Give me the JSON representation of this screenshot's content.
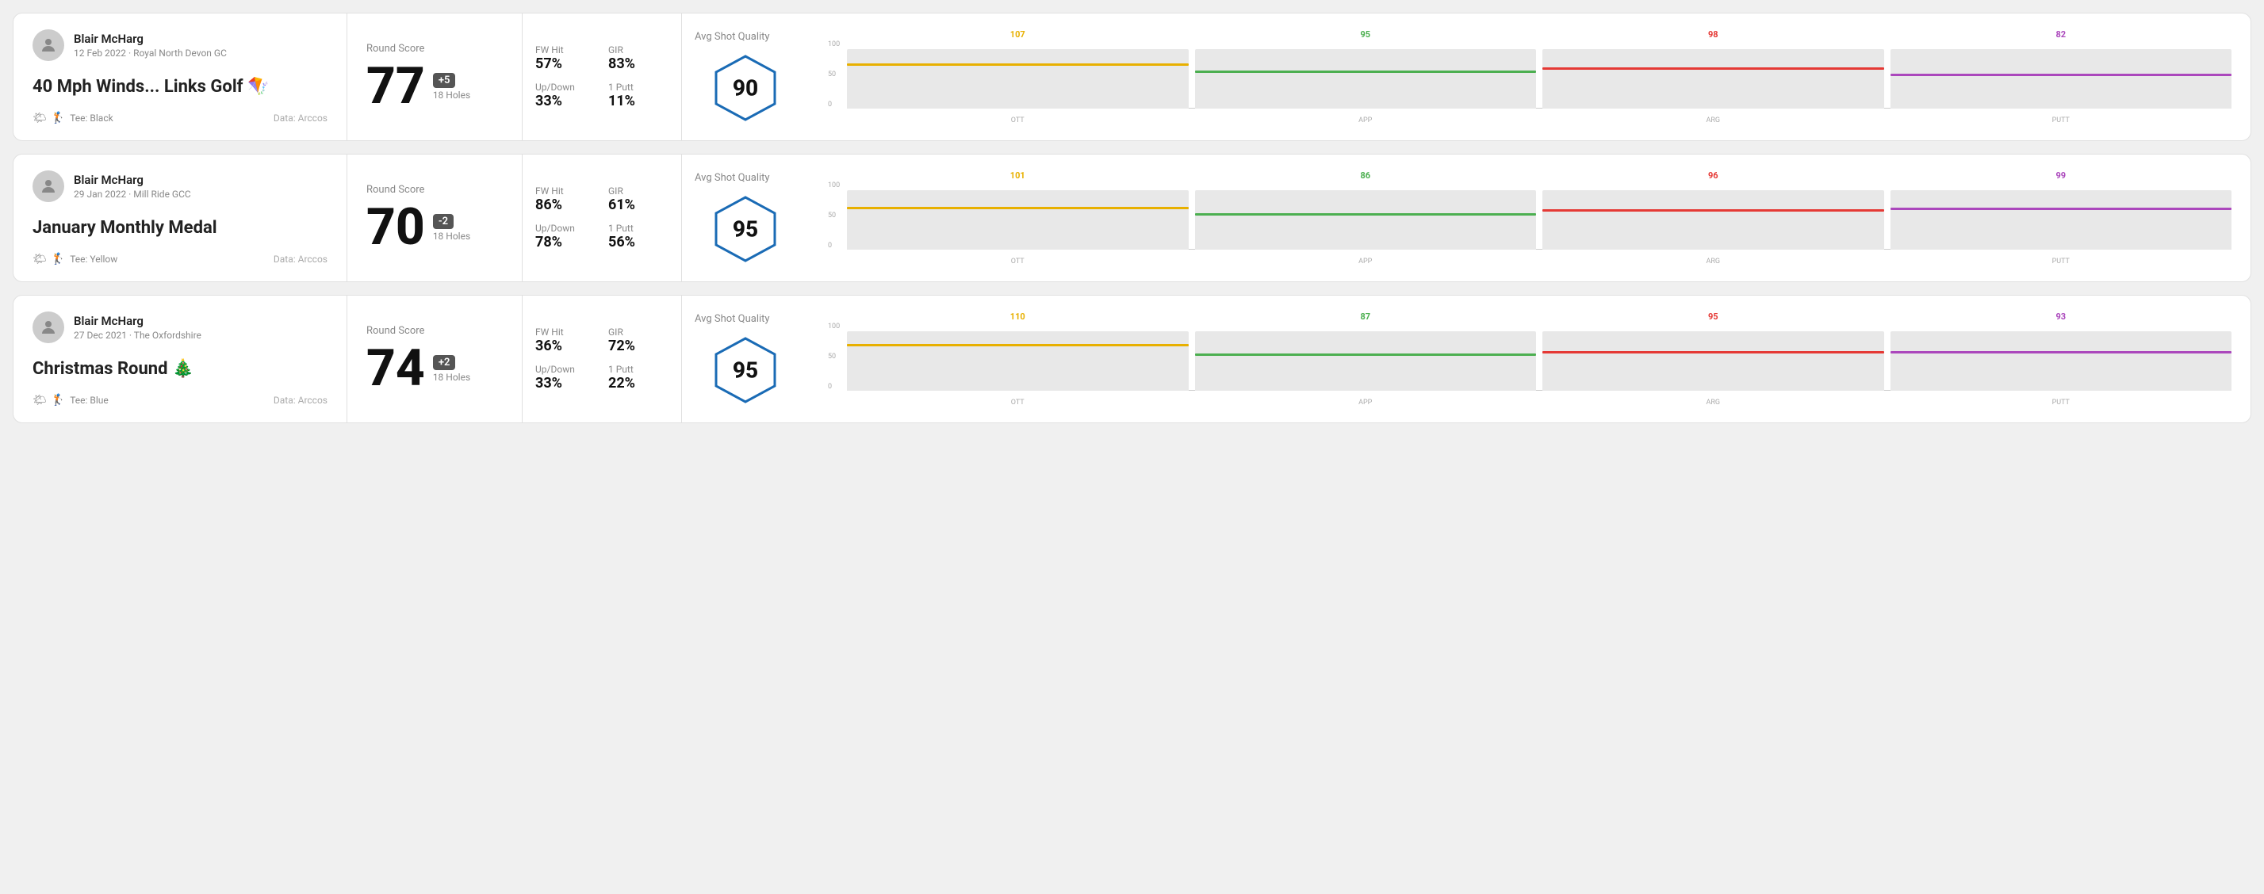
{
  "rounds": [
    {
      "id": "round-1",
      "player": {
        "name": "Blair McHarg",
        "date": "12 Feb 2022",
        "course": "Royal North Devon GC",
        "tee": "Black",
        "tee_color": "#222"
      },
      "title": "40 Mph Winds... Links Golf 🪁",
      "data_source": "Data: Arccos",
      "score": {
        "label": "Round Score",
        "value": "77",
        "badge": "+5",
        "holes": "18 Holes"
      },
      "stats": {
        "fw_hit_label": "FW Hit",
        "fw_hit_value": "57%",
        "gir_label": "GIR",
        "gir_value": "83%",
        "updown_label": "Up/Down",
        "updown_value": "33%",
        "oneputt_label": "1 Putt",
        "oneputt_value": "11%"
      },
      "quality": {
        "label": "Avg Shot Quality",
        "value": "90"
      },
      "chart": {
        "bars": [
          {
            "label": "OTT",
            "top_value": "107",
            "color": "#e8b000",
            "pct": 0.72
          },
          {
            "label": "APP",
            "top_value": "95",
            "color": "#4caf50",
            "pct": 0.6
          },
          {
            "label": "ARG",
            "top_value": "98",
            "color": "#e53935",
            "pct": 0.65
          },
          {
            "label": "PUTT",
            "top_value": "82",
            "color": "#ab47bc",
            "pct": 0.55
          }
        ]
      }
    },
    {
      "id": "round-2",
      "player": {
        "name": "Blair McHarg",
        "date": "29 Jan 2022",
        "course": "Mill Ride GCC",
        "tee": "Yellow",
        "tee_color": "#f4c430"
      },
      "title": "January Monthly Medal",
      "data_source": "Data: Arccos",
      "score": {
        "label": "Round Score",
        "value": "70",
        "badge": "-2",
        "holes": "18 Holes"
      },
      "stats": {
        "fw_hit_label": "FW Hit",
        "fw_hit_value": "86%",
        "gir_label": "GIR",
        "gir_value": "61%",
        "updown_label": "Up/Down",
        "updown_value": "78%",
        "oneputt_label": "1 Putt",
        "oneputt_value": "56%"
      },
      "quality": {
        "label": "Avg Shot Quality",
        "value": "95"
      },
      "chart": {
        "bars": [
          {
            "label": "OTT",
            "top_value": "101",
            "color": "#e8b000",
            "pct": 0.68
          },
          {
            "label": "APP",
            "top_value": "86",
            "color": "#4caf50",
            "pct": 0.57
          },
          {
            "label": "ARG",
            "top_value": "96",
            "color": "#e53935",
            "pct": 0.64
          },
          {
            "label": "PUTT",
            "top_value": "99",
            "color": "#ab47bc",
            "pct": 0.66
          }
        ]
      }
    },
    {
      "id": "round-3",
      "player": {
        "name": "Blair McHarg",
        "date": "27 Dec 2021",
        "course": "The Oxfordshire",
        "tee": "Blue",
        "tee_color": "#1565c0"
      },
      "title": "Christmas Round 🎄",
      "data_source": "Data: Arccos",
      "score": {
        "label": "Round Score",
        "value": "74",
        "badge": "+2",
        "holes": "18 Holes"
      },
      "stats": {
        "fw_hit_label": "FW Hit",
        "fw_hit_value": "36%",
        "gir_label": "GIR",
        "gir_value": "72%",
        "updown_label": "Up/Down",
        "updown_value": "33%",
        "oneputt_label": "1 Putt",
        "oneputt_value": "22%"
      },
      "quality": {
        "label": "Avg Shot Quality",
        "value": "95"
      },
      "chart": {
        "bars": [
          {
            "label": "OTT",
            "top_value": "110",
            "color": "#e8b000",
            "pct": 0.74
          },
          {
            "label": "APP",
            "top_value": "87",
            "color": "#4caf50",
            "pct": 0.58
          },
          {
            "label": "ARG",
            "top_value": "95",
            "color": "#e53935",
            "pct": 0.63
          },
          {
            "label": "PUTT",
            "top_value": "93",
            "color": "#ab47bc",
            "pct": 0.62
          }
        ]
      }
    }
  ]
}
